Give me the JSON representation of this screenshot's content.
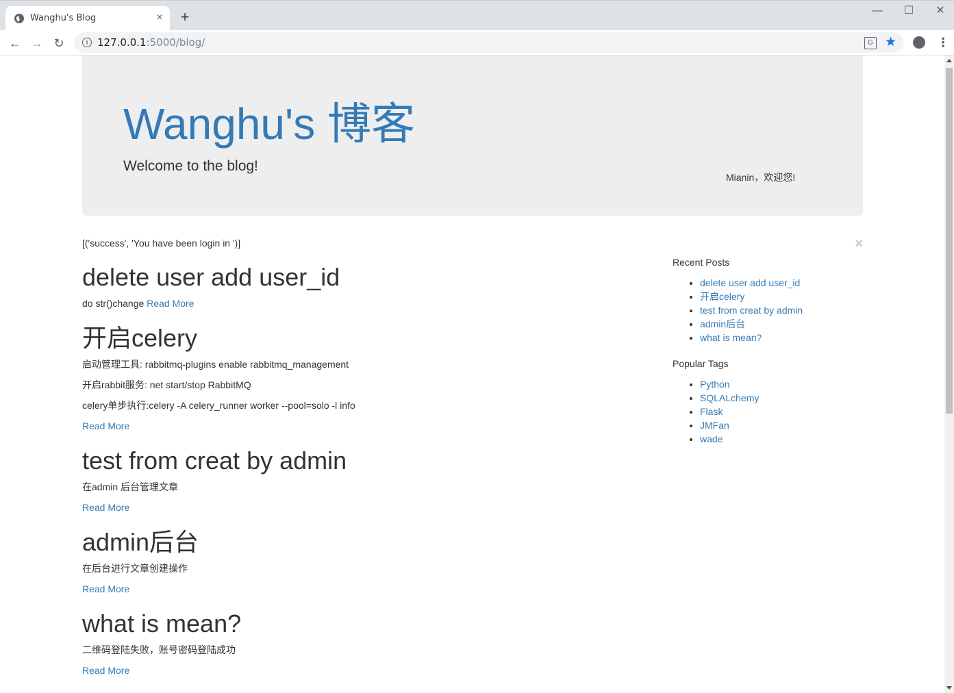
{
  "browser": {
    "tab_title": "Wanghu's Blog",
    "tab_close": "×",
    "new_tab": "+",
    "url_host": "127.0.0.1",
    "url_path": ":5000/blog/",
    "window_minimize": "—",
    "window_maximize": "☐",
    "window_close": "✕",
    "back": "←",
    "forward": "→",
    "reload": "↻",
    "star": "★",
    "menu": "⋮",
    "translate": "G"
  },
  "header": {
    "title": "Wanghu's 博客",
    "subtitle": "Welcome to the blog!",
    "welcome": "Mianin，欢迎您!"
  },
  "flash": {
    "message": "[('success', 'You have been login in ')]",
    "close": "×"
  },
  "posts": [
    {
      "title": "delete user add user_id",
      "lines": [],
      "inline_text": "do str()change ",
      "read_more": "Read More"
    },
    {
      "title": "开启celery",
      "lines": [
        "启动管理工具: rabbitmq-plugins enable rabbitmq_management",
        "开启rabbit服务: net start/stop RabbitMQ",
        "celery单步执行:celery -A celery_runner worker --pool=solo -l info"
      ],
      "read_more": "Read More"
    },
    {
      "title": "test from creat by admin",
      "lines": [
        "在admin 后台管理文章"
      ],
      "read_more": "Read More"
    },
    {
      "title": "admin后台",
      "lines": [
        "在后台进行文章创建操作"
      ],
      "read_more": "Read More"
    },
    {
      "title": "what is mean?",
      "lines": [
        "二维码登陆失败，账号密码登陆成功"
      ],
      "read_more": "Read More"
    }
  ],
  "sidebar": {
    "recent_heading": "Recent Posts",
    "recent": [
      "delete user add user_id",
      "开启celery",
      "test from creat by admin",
      "admin后台",
      "what is mean?"
    ],
    "tags_heading": "Popular Tags",
    "tags": [
      "Python",
      "SQLALchemy",
      "Flask",
      "JMFan",
      "wade"
    ]
  },
  "colors": {
    "link": "#337ab7",
    "jumbotron_bg": "#eeeeee",
    "text": "#333333"
  }
}
